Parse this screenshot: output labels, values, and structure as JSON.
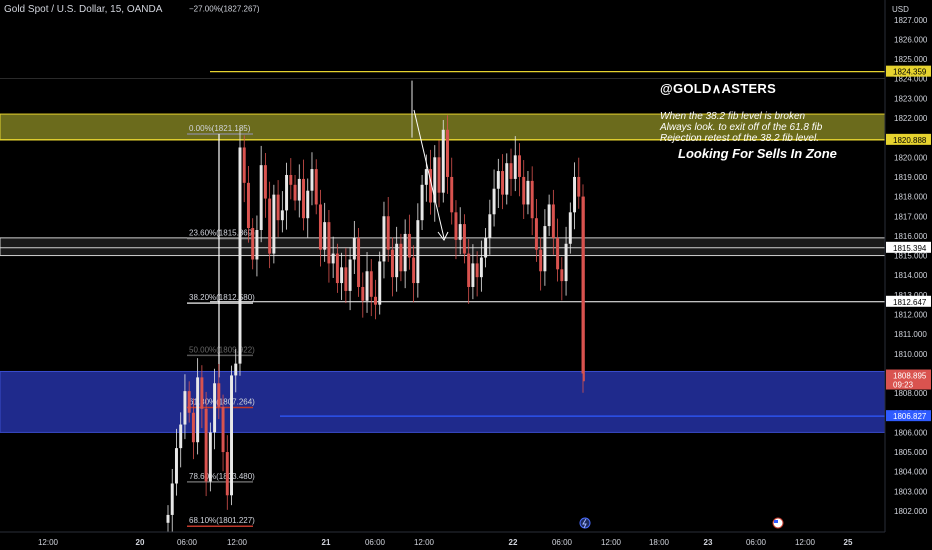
{
  "header": {
    "symbol": "Gold Spot / U.S. Dollar, 15, OANDA",
    "currency": "USD"
  },
  "annotations": {
    "brand": "@GOLD∧ASTERS",
    "note_lines": [
      "When the 38.2 fib level is broken",
      "Always look. to exit off of the 61.8 fib",
      "Rejection retest of the 38.2 fib level."
    ],
    "zone_label": "Looking For Sells In Zone"
  },
  "colors": {
    "background": "#000000",
    "bull": "#e8e8e8",
    "bear": "#d9534f",
    "resistance_zone": "#6b6b1c",
    "demand_zone": "#1f2a8c",
    "yellow_line": "#e6d32f",
    "blue_line": "#2f5bff"
  },
  "chart_data": {
    "type": "candlestick",
    "title": "Gold Spot / U.S. Dollar, 15, OANDA",
    "ylabel": "USD",
    "ylim": [
      1801.2,
      1827.5
    ],
    "y_ticks": [
      1802,
      1803,
      1804,
      1805,
      1806,
      1807,
      1808,
      1809,
      1810,
      1811,
      1812,
      1813,
      1814,
      1815,
      1816,
      1817,
      1818,
      1819,
      1820,
      1821,
      1822,
      1823,
      1824,
      1825,
      1826,
      1827
    ],
    "x_ticks": [
      "12:00",
      "20",
      "06:00",
      "12:00",
      "21",
      "06:00",
      "12:00",
      "22",
      "06:00",
      "12:00",
      "18:00",
      "23",
      "06:00",
      "12:00",
      "25"
    ],
    "price_labels": [
      {
        "text": "1824.359",
        "value": 1824.359,
        "style": "yellow"
      },
      {
        "text": "1820.888",
        "value": 1820.888,
        "style": "yellow"
      },
      {
        "text": "1815.394",
        "value": 1815.394,
        "style": "white"
      },
      {
        "text": "1812.647",
        "value": 1812.647,
        "style": "white"
      },
      {
        "text": "1808.895",
        "sub": "09:23",
        "value": 1808.895,
        "style": "red"
      },
      {
        "text": "1806.827",
        "value": 1806.827,
        "style": "blue"
      }
    ],
    "fib_levels": [
      {
        "label": "−27.00%(1827.267)",
        "value": 1827.267,
        "color": "#888888"
      },
      {
        "label": "0.00%(1821.185)",
        "value": 1821.185,
        "color": "#888888"
      },
      {
        "label": "23.60%(1815.869)",
        "value": 1815.869,
        "color": "#888888"
      },
      {
        "label": "38.20%(1812.580)",
        "value": 1812.58,
        "color": "#cccccc"
      },
      {
        "label": "50.00%(1809.922)",
        "value": 1809.922,
        "color": "#555555"
      },
      {
        "label": "61.80%(1807.264)",
        "value": 1807.264,
        "color": "#c0392b"
      },
      {
        "label": "78.60%(1803.480)",
        "value": 1803.48,
        "color": "#666666"
      },
      {
        "label": "68.10%(1801.227)",
        "value": 1801.227,
        "color": "#c0392b"
      }
    ],
    "zones": [
      {
        "name": "resistance",
        "from": 1820.9,
        "to": 1822.2
      },
      {
        "name": "demand",
        "from": 1806.0,
        "to": 1809.1
      }
    ],
    "candles_close": [
      1801.8,
      1803.4,
      1805.2,
      1806.4,
      1808.1,
      1807.0,
      1805.5,
      1808.8,
      1807.2,
      1803.5,
      1806.0,
      1808.5,
      1807.3,
      1805.0,
      1802.8,
      1808.9,
      1809.5,
      1820.5,
      1818.7,
      1816.4,
      1814.8,
      1816.3,
      1819.6,
      1817.9,
      1815.1,
      1818.1,
      1816.8,
      1817.3,
      1819.1,
      1818.6,
      1817.8,
      1818.9,
      1816.9,
      1818.3,
      1819.4,
      1817.6,
      1815.3,
      1816.7,
      1814.6,
      1815.1,
      1813.6,
      1814.4,
      1813.2,
      1814.8,
      1815.9,
      1813.4,
      1812.7,
      1814.2,
      1812.9,
      1812.5,
      1814.7,
      1817.0,
      1815.3,
      1813.9,
      1815.6,
      1814.2,
      1816.1,
      1814.9,
      1813.6,
      1816.8,
      1818.6,
      1819.4,
      1817.7,
      1820.0,
      1818.2,
      1821.4,
      1819.0,
      1817.2,
      1815.8,
      1816.6,
      1815.1,
      1813.4,
      1814.6,
      1813.9,
      1814.9,
      1815.9,
      1817.1,
      1818.4,
      1819.3,
      1818.1,
      1819.7,
      1818.9,
      1820.1,
      1819.0,
      1817.6,
      1818.8,
      1816.9,
      1815.3,
      1814.2,
      1816.5,
      1817.6,
      1815.9,
      1814.3,
      1813.7,
      1815.6,
      1817.2,
      1819.0,
      1818.0,
      1809.0
    ]
  }
}
